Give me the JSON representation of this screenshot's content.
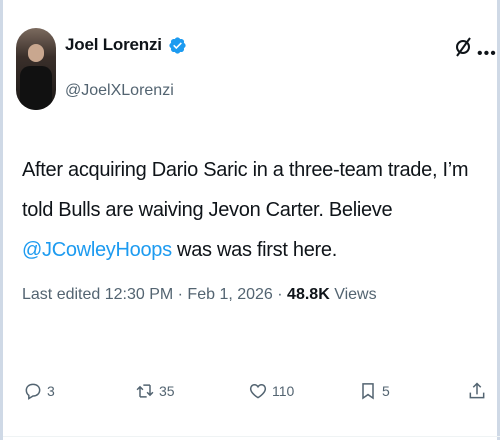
{
  "author": {
    "display_name": "Joel Lorenzi",
    "handle": "@JoelXLorenzi",
    "verified": true
  },
  "tweet": {
    "text_part1": "After acquiring Dario Saric in a three-team trade, I’m told Bulls are waiving Jevon Carter. Believe ",
    "mention": "@JCowleyHoops",
    "text_part2": " was was first here."
  },
  "meta": {
    "edited_label": "Last edited 12:30 PM · Feb 1, 2026 · ",
    "views_count": "48.8K",
    "views_label": " Views"
  },
  "actions": {
    "replies": "3",
    "reposts": "35",
    "likes": "110",
    "bookmarks": "5"
  },
  "colors": {
    "accent": "#1d9bf0",
    "secondary_text": "#536471",
    "primary_text": "#0f1419"
  },
  "icons": [
    "verified-badge-icon",
    "grok-icon",
    "more-icon",
    "reply-icon",
    "retweet-icon",
    "like-icon",
    "bookmark-icon",
    "share-icon"
  ]
}
